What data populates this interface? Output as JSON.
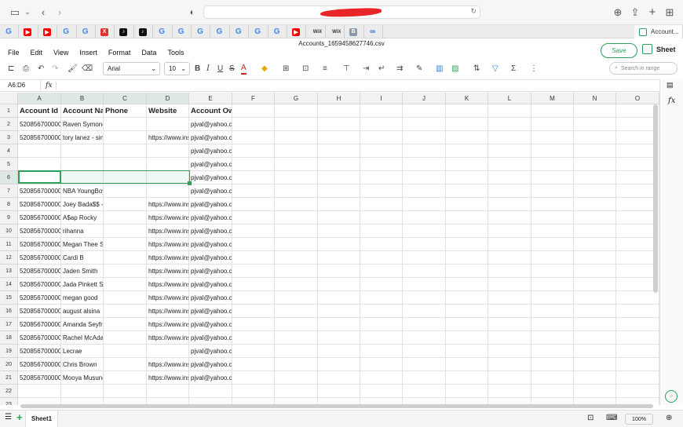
{
  "browser": {
    "tabs": [
      {
        "icon": "google-icon",
        "glyph": "G",
        "cls": "g"
      },
      {
        "icon": "youtube-icon",
        "glyph": "▶",
        "cls": "yt"
      },
      {
        "icon": "youtube-icon",
        "glyph": "▶",
        "cls": "yt"
      },
      {
        "icon": "google-icon",
        "glyph": "G",
        "cls": "g"
      },
      {
        "icon": "google-icon",
        "glyph": "G",
        "cls": "g"
      },
      {
        "icon": "x-icon",
        "glyph": "X",
        "cls": "x"
      },
      {
        "icon": "tiktok-icon",
        "glyph": "♪",
        "cls": "tk"
      },
      {
        "icon": "tiktok-icon",
        "glyph": "♪",
        "cls": "tk"
      },
      {
        "icon": "google-icon",
        "glyph": "G",
        "cls": "g"
      },
      {
        "icon": "google-icon",
        "glyph": "G",
        "cls": "g"
      },
      {
        "icon": "google-icon",
        "glyph": "G",
        "cls": "g"
      },
      {
        "icon": "google-icon",
        "glyph": "G",
        "cls": "g"
      },
      {
        "icon": "google-icon",
        "glyph": "G",
        "cls": "g"
      },
      {
        "icon": "google-icon",
        "glyph": "G",
        "cls": "g"
      },
      {
        "icon": "google-icon",
        "glyph": "G",
        "cls": "g"
      },
      {
        "icon": "youtube-icon",
        "glyph": "▶",
        "cls": "yt"
      },
      {
        "icon": "wix-icon",
        "glyph": "WiX",
        "cls": "wix"
      },
      {
        "icon": "wix-icon",
        "glyph": "WiX",
        "cls": "wix"
      },
      {
        "icon": "b-icon",
        "glyph": "B",
        "cls": "b"
      },
      {
        "icon": "link-icon",
        "glyph": "∞",
        "cls": "ac"
      }
    ],
    "active_tab": {
      "title": "Account..."
    }
  },
  "document": {
    "title": "Accounts_1659458627746.csv"
  },
  "menu": [
    "File",
    "Edit",
    "View",
    "Insert",
    "Format",
    "Data",
    "Tools"
  ],
  "actions": {
    "save_label": "Save",
    "brand_label": "Sheet"
  },
  "toolbar": {
    "font": "Arial",
    "font_size": "10",
    "search_placeholder": "Search in range"
  },
  "formula": {
    "cell_ref": "A6:D6",
    "fx": "fx"
  },
  "columns": [
    "A",
    "B",
    "C",
    "D",
    "E",
    "F",
    "G",
    "H",
    "I",
    "J",
    "K",
    "L",
    "M",
    "N",
    "O"
  ],
  "rows": [
    [
      "Account Id",
      "Account Name",
      "Phone",
      "Website",
      "Account Owner"
    ],
    [
      "520856700000",
      "Raven Symone",
      "",
      "",
      "pjval@yahoo.com"
    ],
    [
      "520856700000",
      "tory lanez - singer",
      "",
      "https://www.instagram.com",
      "pjval@yahoo.com"
    ],
    [
      "",
      "",
      "",
      "",
      "pjval@yahoo.com"
    ],
    [
      "",
      "",
      "",
      "",
      "pjval@yahoo.com"
    ],
    [
      "",
      "",
      "",
      "",
      "pjval@yahoo.com"
    ],
    [
      "520856700000",
      "NBA YoungBoy",
      "",
      "",
      "pjval@yahoo.com"
    ],
    [
      "520856700000",
      "Joey Bada$$ - rapper",
      "",
      "https://www.instagram.com",
      "pjval@yahoo.com"
    ],
    [
      "520856700000",
      "A$ap Rocky",
      "",
      "https://www.instagram.com",
      "pjval@yahoo.com"
    ],
    [
      "520856700000",
      "rihanna",
      "",
      "https://www.instagram.com",
      "pjval@yahoo.com"
    ],
    [
      "520856700000",
      "Megan Thee Stallion",
      "",
      "https://www.instagram.com",
      "pjval@yahoo.com"
    ],
    [
      "520856700000",
      "Cardi B",
      "",
      "https://www.instagram.com",
      "pjval@yahoo.com"
    ],
    [
      "520856700000",
      "Jaden Smith",
      "",
      "https://www.instagram.com",
      "pjval@yahoo.com"
    ],
    [
      "520856700000",
      "Jada Pinkett Smith",
      "",
      "https://www.instagram.com",
      "pjval@yahoo.com"
    ],
    [
      "520856700000",
      "megan good",
      "",
      "https://www.instagram.com",
      "pjval@yahoo.com"
    ],
    [
      "520856700000",
      "august alsina",
      "",
      "https://www.instagram.com",
      "pjval@yahoo.com"
    ],
    [
      "520856700000",
      "Amanda Seyfried - partner",
      "",
      "https://www.instagram.com",
      "pjval@yahoo.com"
    ],
    [
      "520856700000",
      "Rachel McAdams - partner",
      "",
      "https://www.instagram.com",
      "pjval@yahoo.com"
    ],
    [
      "520856700000",
      "Lecrae",
      "",
      "",
      "pjval@yahoo.com"
    ],
    [
      "520856700000",
      "Chris Brown",
      "",
      "https://www.instagram.com",
      "pjval@yahoo.com"
    ],
    [
      "520856700000",
      "Mooya Musunga",
      "",
      "https://www.instagram.com",
      "pjval@yahoo.com"
    ],
    [
      "",
      "",
      "",
      "",
      ""
    ],
    [
      "",
      "",
      "",
      "",
      ""
    ]
  ],
  "bottom": {
    "sheet_tab": "Sheet1",
    "zoom": "100%",
    "add": "+"
  },
  "colors": {
    "accent": "#2e9e5b"
  }
}
